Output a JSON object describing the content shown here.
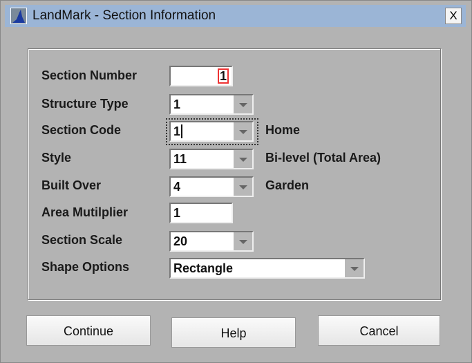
{
  "window": {
    "title": "LandMark - Section Information",
    "close_label": "X"
  },
  "fields": {
    "section_number": {
      "label": "Section Number",
      "value": "1"
    },
    "structure_type": {
      "label": "Structure Type",
      "value": "1"
    },
    "section_code": {
      "label": "Section Code",
      "value": "1",
      "description": "Home"
    },
    "style": {
      "label": "Style",
      "value": "11",
      "description": "Bi-level (Total Area)"
    },
    "built_over": {
      "label": "Built Over",
      "value": "4",
      "description": "Garden"
    },
    "area_multiplier": {
      "label": "Area Mutilplier",
      "value": "1"
    },
    "section_scale": {
      "label": "Section Scale",
      "value": "20"
    },
    "shape_options": {
      "label": "Shape Options",
      "value": "Rectangle"
    }
  },
  "buttons": {
    "continue": "Continue",
    "help": "Help",
    "cancel": "Cancel"
  }
}
